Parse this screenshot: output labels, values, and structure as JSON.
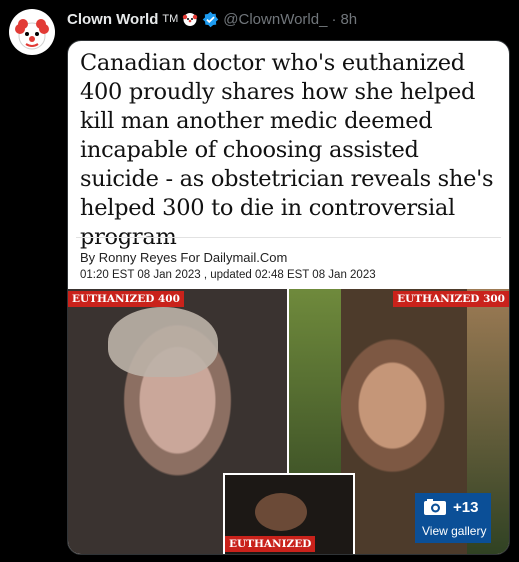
{
  "tweet": {
    "author_name": "Clown World",
    "tm": "TM",
    "handle": "@ClownWorld_",
    "separator": "·",
    "time": "8h",
    "icons": [
      "clown-face-icon",
      "verified-badge-icon"
    ],
    "colors": {
      "background": "#000000",
      "verified": "#1d9bf0",
      "muted": "#71767b"
    }
  },
  "article": {
    "headline": "Canadian doctor who's euthanized 400 proudly shares how she helped kill man another medic deemed incapable of choosing assisted suicide - as obstetrician reveals she's helped 300 to die in controversial program",
    "byline": "By Ronny Reyes For Dailymail.Com",
    "dateline": "01:20 EST 08 Jan 2023 , updated 02:48 EST 08 Jan 2023",
    "labels": {
      "left": "EUTHANIZED 400",
      "right": "EUTHANIZED 300",
      "inset": "EUTHANIZED"
    },
    "gallery": {
      "count": "+13",
      "label": "View gallery"
    },
    "colors": {
      "label_red": "#c9221b",
      "gallery_blue": "#0b4f97"
    }
  }
}
